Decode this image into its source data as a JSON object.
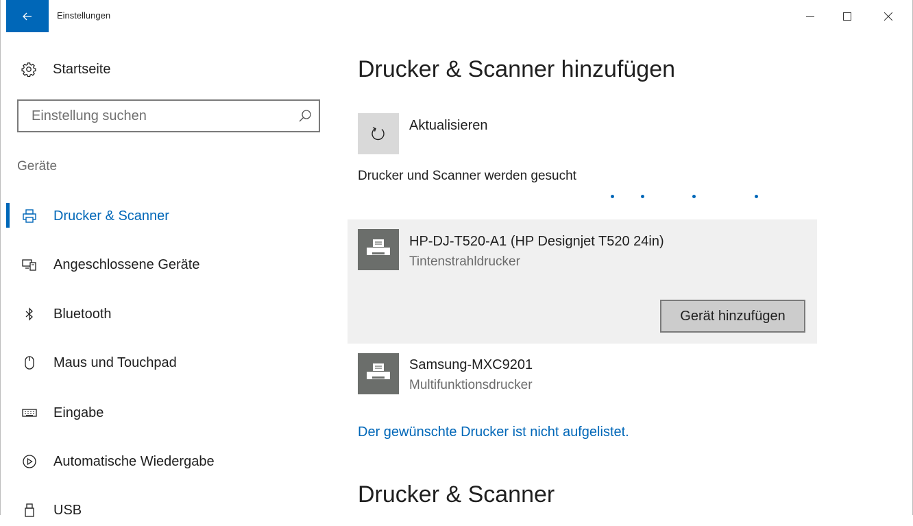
{
  "window": {
    "title": "Einstellungen",
    "icons": {
      "back": "back-arrow-icon",
      "minimize": "minimize-icon",
      "maximize": "maximize-icon",
      "close": "close-icon"
    }
  },
  "sidebar": {
    "home_label": "Startseite",
    "search_placeholder": "Einstellung suchen",
    "section_label": "Geräte",
    "items": [
      {
        "label": "Drucker & Scanner",
        "icon": "printer-icon",
        "active": true
      },
      {
        "label": "Angeschlossene Geräte",
        "icon": "connected-devices-icon",
        "active": false
      },
      {
        "label": "Bluetooth",
        "icon": "bluetooth-icon",
        "active": false
      },
      {
        "label": "Maus und Touchpad",
        "icon": "mouse-icon",
        "active": false
      },
      {
        "label": "Eingabe",
        "icon": "keyboard-icon",
        "active": false
      },
      {
        "label": "Automatische Wiedergabe",
        "icon": "autoplay-icon",
        "active": false
      },
      {
        "label": "USB",
        "icon": "usb-icon",
        "active": false
      }
    ]
  },
  "main": {
    "title": "Drucker & Scanner hinzufügen",
    "refresh_label": "Aktualisieren",
    "status": "Drucker und Scanner werden gesucht",
    "devices": [
      {
        "name": "HP-DJ-T520-A1 (HP Designjet T520 24in)",
        "type": "Tintenstrahldrucker",
        "selected": true
      },
      {
        "name": "Samsung-MXC9201",
        "type": "Multifunktionsdrucker",
        "selected": false
      }
    ],
    "add_button": "Gerät hinzufügen",
    "not_listed_link": "Der gewünschte Drucker ist nicht aufgelistet.",
    "section2_title": "Drucker & Scanner"
  },
  "colors": {
    "accent": "#0067b8",
    "card_bg": "#f0f0f0",
    "device_icon_bg": "#6b6e6b"
  }
}
